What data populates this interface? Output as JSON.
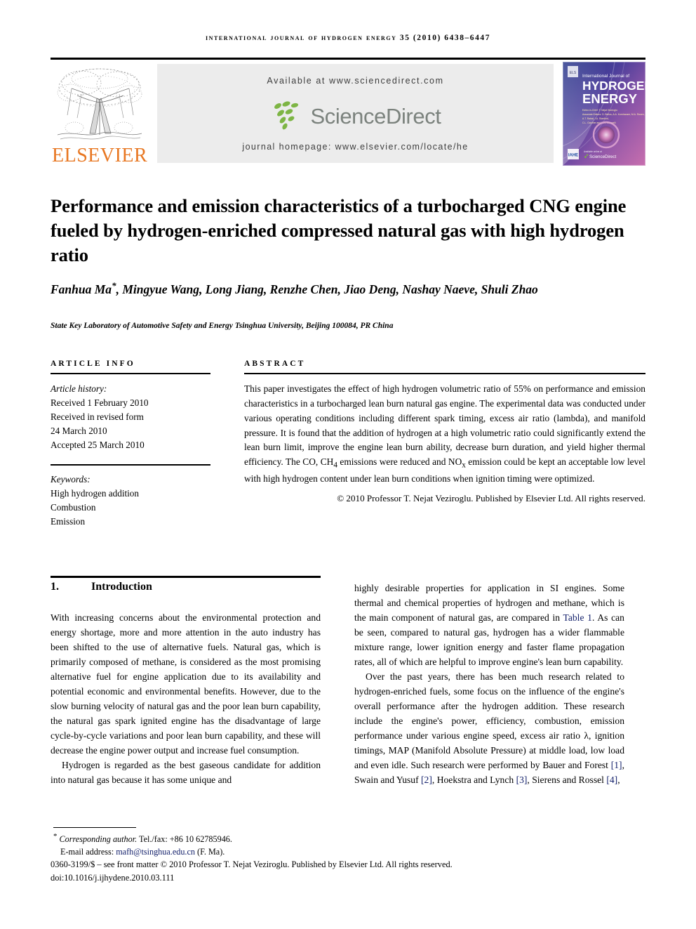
{
  "running_head": "International Journal of Hydrogen Energy 35 (2010) 6438–6447",
  "masthead": {
    "publisher_name": "ELSEVIER",
    "available_at": "Available at www.sciencedirect.com",
    "sciencedirect_wordmark": "ScienceDirect",
    "journal_homepage": "journal homepage: www.elsevier.com/locate/he",
    "cover": {
      "line1": "International Journal of",
      "line2": "HYDROGEN",
      "line3": "ENERGY",
      "editor_line1": "Editor-in-Chief: T. Nejat Veziroglu",
      "editor_line2": "Associate Editors: D. Bellos, A.A. Kornhauser, M.A. Rosen,",
      "editor_line3": "A.T. Raissi, I.A. Stanford,",
      "editor_line4": "C.L. Gardner and E.A. Ticianelli",
      "footer_badge": "IAHE",
      "footer_text": "Available online at",
      "footer_sd": "ScienceDirect"
    }
  },
  "article": {
    "title": "Performance and emission characteristics of a turbocharged CNG engine fueled by hydrogen-enriched compressed natural gas with high hydrogen ratio",
    "authors": "Fanhua Ma*, Mingyue Wang, Long Jiang, Renzhe Chen, Jiao Deng, Nashay Naeve, Shuli Zhao",
    "affiliation": "State Key Laboratory of Automotive Safety and Energy Tsinghua University, Beijing 100084, PR China"
  },
  "article_info": {
    "heading": "Article Info",
    "history_label": "Article history:",
    "history": [
      "Received 1 February 2010",
      "Received in revised form",
      "24 March 2010",
      "Accepted 25 March 2010"
    ],
    "keywords_label": "Keywords:",
    "keywords": [
      "High hydrogen addition",
      "Combustion",
      "Emission"
    ]
  },
  "abstract": {
    "heading": "Abstract",
    "body": "This paper investigates the effect of high hydrogen volumetric ratio of 55% on performance and emission characteristics in a turbocharged lean burn natural gas engine. The experimental data was conducted under various operating conditions including different spark timing, excess air ratio (lambda), and manifold pressure. It is found that the addition of hydrogen at a high volumetric ratio could significantly extend the lean burn limit, improve the engine lean burn ability, decrease burn duration, and yield higher thermal efficiency. The CO, CH4 emissions were reduced and NOx emission could be kept an acceptable low level with high hydrogen content under lean burn conditions when ignition timing were optimized.",
    "copyright": "© 2010 Professor T. Nejat Veziroglu. Published by Elsevier Ltd. All rights reserved."
  },
  "introduction": {
    "number": "1.",
    "title": "Introduction",
    "left_para_1": "With increasing concerns about the environmental protection and energy shortage, more and more attention in the auto industry has been shifted to the use of alternative fuels. Natural gas, which is primarily composed of methane, is considered as the most promising alternative fuel for engine application due to its availability and potential economic and environmental benefits. However, due to the slow burning velocity of natural gas and the poor lean burn capability, the natural gas spark ignited engine has the disadvantage of large cycle-by-cycle variations and poor lean burn capability, and these will decrease the engine power output and increase fuel consumption.",
    "left_para_2": "Hydrogen is regarded as the best gaseous candidate for addition into natural gas because it has some unique and",
    "right_para_1_a": "highly desirable properties for application in SI engines. Some thermal and chemical properties of hydrogen and methane, which is the main component of natural gas, are compared in ",
    "right_para_1_link": "Table 1",
    "right_para_1_b": ". As can be seen, compared to natural gas, hydrogen has a wider flammable mixture range, lower ignition energy and faster flame propagation rates, all of which are helpful to improve engine's lean burn capability.",
    "right_para_2_a": "Over the past years, there has been much research related to hydrogen-enriched fuels, some focus on the influence of the engine's overall performance after the hydrogen addition. These research include the engine's power, efficiency, combustion, emission performance under various engine speed, excess air ratio λ, ignition timings, MAP (Manifold Absolute Pressure) at middle load, low load and even idle. Such research were performed by Bauer and Forest ",
    "ref1": "[1]",
    "right_para_2_b": ", Swain and Yusuf ",
    "ref2": "[2]",
    "right_para_2_c": ", Hoekstra and Lynch ",
    "ref3": "[3]",
    "right_para_2_d": ", Sierens and Rossel ",
    "ref4": "[4]",
    "right_para_2_e": ","
  },
  "footer": {
    "corresponding_label": "Corresponding author.",
    "corresponding_tel": " Tel./fax: +86 10 62785946.",
    "email_label": "E-mail address: ",
    "email": "mafh@tsinghua.edu.cn",
    "email_suffix": " (F. Ma).",
    "imprint_line1": "0360-3199/$ – see front matter © 2010 Professor T. Nejat Veziroglu. Published by Elsevier Ltd. All rights reserved.",
    "imprint_line2": "doi:10.1016/j.ijhydene.2010.03.111"
  },
  "colors": {
    "elsevier_orange": "#E87722",
    "sciencedirect_gray": "#7b827d",
    "link_blue": "#13206b",
    "banner_gray": "#ececec"
  }
}
